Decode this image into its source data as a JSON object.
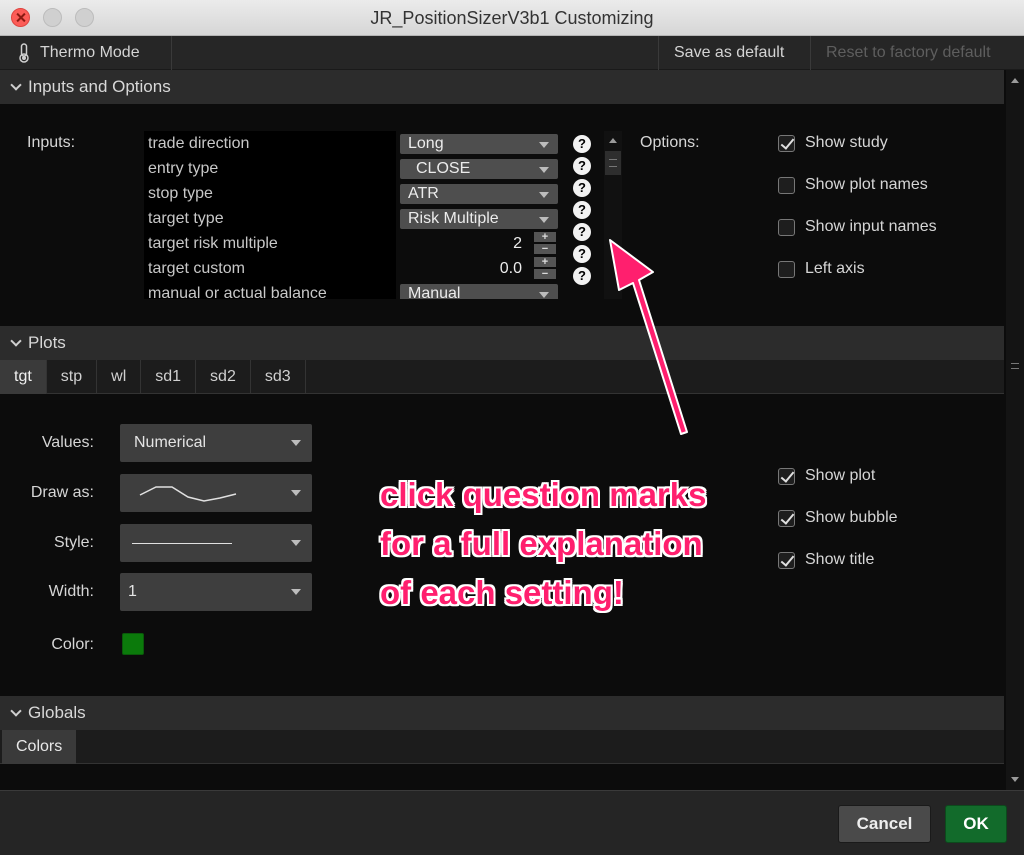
{
  "window": {
    "title": "JR_PositionSizerV3b1 Customizing"
  },
  "toolbar": {
    "thermo_label": "Thermo Mode",
    "save_default": "Save as default",
    "reset_default": "Reset to factory default"
  },
  "sections": {
    "inputs": "Inputs and Options",
    "plots": "Plots",
    "globals": "Globals"
  },
  "inputs": {
    "label": "Inputs:",
    "rows": [
      {
        "name": "trade direction",
        "value": "Long"
      },
      {
        "name": "entry type",
        "value": "CLOSE"
      },
      {
        "name": "stop type",
        "value": "ATR"
      },
      {
        "name": "target type",
        "value": "Risk Multiple"
      },
      {
        "name": "target risk multiple",
        "value": "2"
      },
      {
        "name": "target custom",
        "value": "0.0"
      },
      {
        "name": "manual or actual balance",
        "value": "Manual"
      }
    ]
  },
  "options": {
    "label": "Options:",
    "items": [
      {
        "label": "Show study",
        "checked": true
      },
      {
        "label": "Show plot names",
        "checked": false
      },
      {
        "label": "Show input names",
        "checked": false
      },
      {
        "label": "Left axis",
        "checked": false
      }
    ]
  },
  "plots": {
    "tabs": [
      "tgt",
      "stp",
      "wl",
      "sd1",
      "sd2",
      "sd3"
    ],
    "active_tab": "tgt",
    "labels": {
      "values": "Values:",
      "draw_as": "Draw as:",
      "style": "Style:",
      "width": "Width:",
      "color": "Color:"
    },
    "values_value": "Numerical",
    "width_value": "1",
    "color_hex": "#0b7a0b",
    "checks": [
      {
        "label": "Show plot",
        "checked": true
      },
      {
        "label": "Show bubble",
        "checked": true
      },
      {
        "label": "Show title",
        "checked": true
      }
    ]
  },
  "annotation": {
    "lines": [
      "click question marks",
      "for a full explanation",
      "of each setting!"
    ],
    "color": "#ff1f6e"
  },
  "globals": {
    "tab": "Colors"
  },
  "footer": {
    "cancel": "Cancel",
    "ok": "OK"
  }
}
